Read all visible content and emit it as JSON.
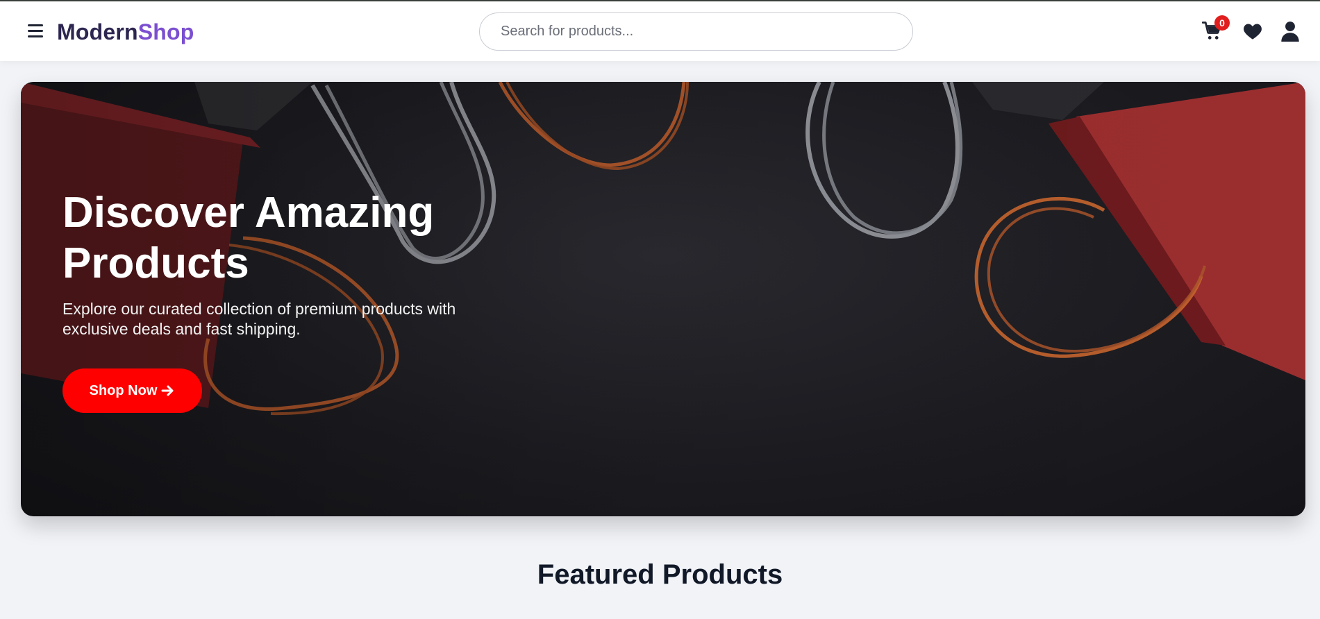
{
  "header": {
    "logo_part1": "Modern",
    "logo_part2": "Shop",
    "search_placeholder": "Search for products...",
    "cart_count": "0",
    "icons": [
      "menu-icon",
      "cart-icon",
      "heart-icon",
      "user-icon"
    ]
  },
  "hero": {
    "title": "Discover Amazing Products",
    "subtitle": "Explore our curated collection of premium products with exclusive deals and fast shipping.",
    "cta_label": "Shop Now",
    "cta_icon": "arrow-right-icon"
  },
  "featured": {
    "title": "Featured Products"
  },
  "colors": {
    "brand_dark": "#2d2650",
    "brand_accent": "#7b4fd0",
    "cta": "#ff0000",
    "badge": "#e11d1d",
    "hero_bg": "#1c1c21"
  }
}
